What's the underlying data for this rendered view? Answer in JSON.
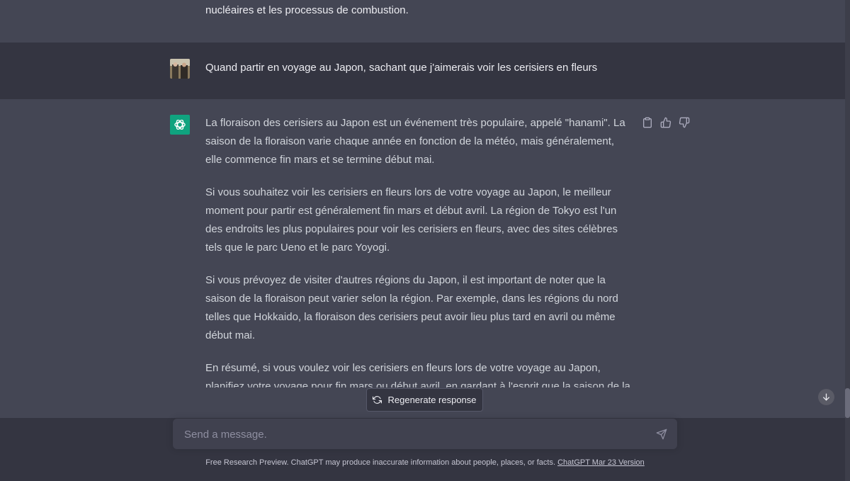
{
  "previous_message": {
    "text": "nucléaires et les processus de combustion."
  },
  "user_message": {
    "text": "Quand partir en voyage au Japon, sachant que j'aimerais voir les cerisiers en fleurs"
  },
  "assistant_message": {
    "paragraphs": [
      "La floraison des cerisiers au Japon est un événement très populaire, appelé \"hanami\". La saison de la floraison varie chaque année en fonction de la météo, mais généralement, elle commence fin mars et se termine début mai.",
      "Si vous souhaitez voir les cerisiers en fleurs lors de votre voyage au Japon, le meilleur moment pour partir est généralement fin mars et début avril. La région de Tokyo est l'un des endroits les plus populaires pour voir les cerisiers en fleurs, avec des sites célèbres tels que le parc Ueno et le parc Yoyogi.",
      "Si vous prévoyez de visiter d'autres régions du Japon, il est important de noter que la saison de la floraison peut varier selon la région. Par exemple, dans les régions du nord telles que Hokkaido, la floraison des cerisiers peut avoir lieu plus tard en avril ou même début mai.",
      "En résumé, si vous voulez voir les cerisiers en fleurs lors de votre voyage au Japon, planifiez votre voyage pour fin mars ou début avril, en gardant à l'esprit que la saison de la floraison peut varier légèrement selon la région."
    ],
    "actions": [
      "copy-icon",
      "thumbs-up-icon",
      "thumbs-down-icon"
    ]
  },
  "regenerate": {
    "label": "Regenerate response",
    "icon": "refresh-icon"
  },
  "composer": {
    "placeholder": "Send a message.",
    "value": "",
    "send_icon": "send-icon"
  },
  "footer": {
    "text": "Free Research Preview. ChatGPT may produce inaccurate information about people, places, or facts.",
    "link": "ChatGPT Mar 23 Version"
  },
  "colors": {
    "accent": "#10a37f",
    "bg_assistant": "#444654",
    "bg_user": "#343541"
  }
}
